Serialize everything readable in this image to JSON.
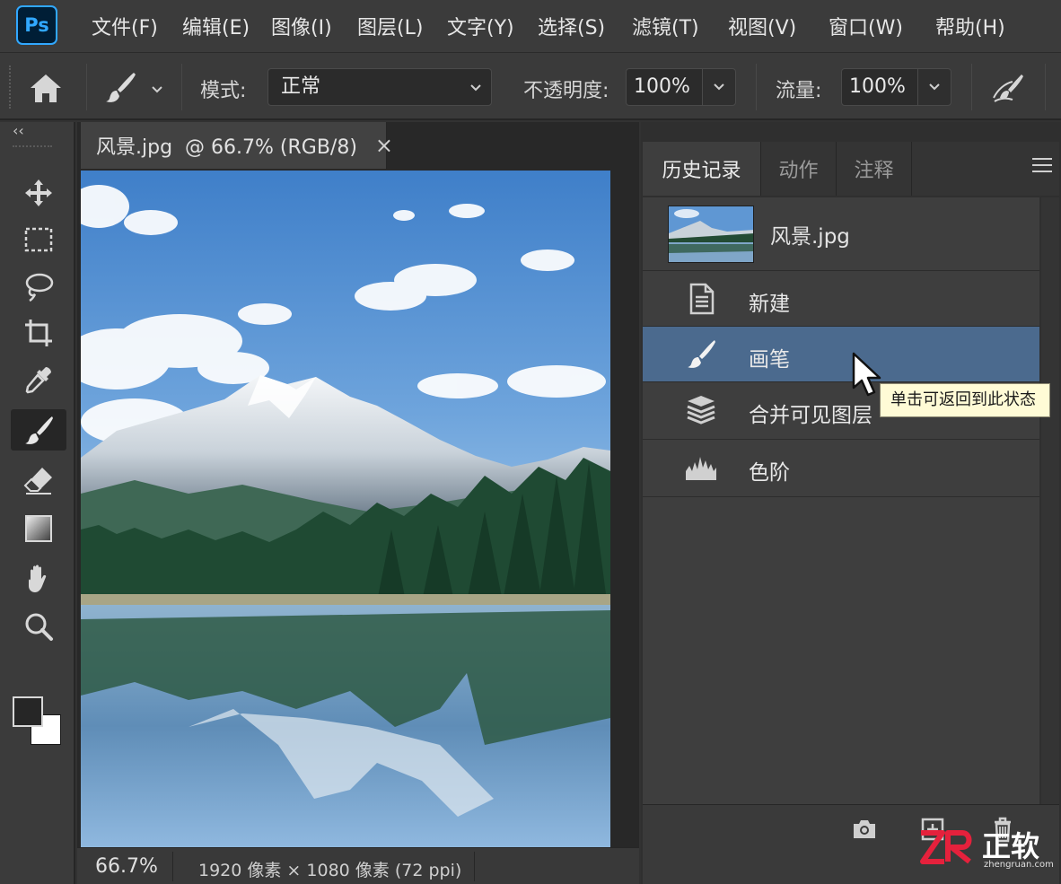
{
  "app": {
    "logo": "Ps",
    "menus": [
      "文件(F)",
      "编辑(E)",
      "图像(I)",
      "图层(L)",
      "文字(Y)",
      "选择(S)",
      "滤镜(T)",
      "视图(V)",
      "窗口(W)",
      "帮助(H)"
    ]
  },
  "options": {
    "mode_label": "模式:",
    "mode_value": "正常",
    "opacity_label": "不透明度:",
    "opacity_value": "100%",
    "flow_label": "流量:",
    "flow_value": "100%"
  },
  "toolbar": {
    "collapse": "‹‹",
    "active_tool": "brush-tool"
  },
  "document": {
    "tab_title": "风景.jpg  @ 66.7% (RGB/8)",
    "close_glyph": "×",
    "zoom": "66.7%",
    "info": "1920 像素 × 1080 像素 (72 ppi)"
  },
  "history_panel": {
    "tabs": [
      "历史记录",
      "动作",
      "注释"
    ],
    "snapshot_label": "风景.jpg",
    "items": [
      {
        "label": "新建",
        "icon": "document-icon"
      },
      {
        "label": "画笔",
        "icon": "brush-icon"
      },
      {
        "label": "合并可见图层",
        "icon": "merge-layers-icon"
      },
      {
        "label": "色阶",
        "icon": "levels-icon"
      }
    ],
    "selected_index": 1,
    "tooltip": "单击可返回到此状态"
  },
  "watermark": {
    "mark": "ZR",
    "brand": "正软",
    "url": "zhengruan.com"
  },
  "colors": {
    "selection": "#4b6a8e",
    "ps_blue": "#31a8ff",
    "tooltip_bg": "#fffbd6",
    "watermark_red": "#e5213c"
  }
}
